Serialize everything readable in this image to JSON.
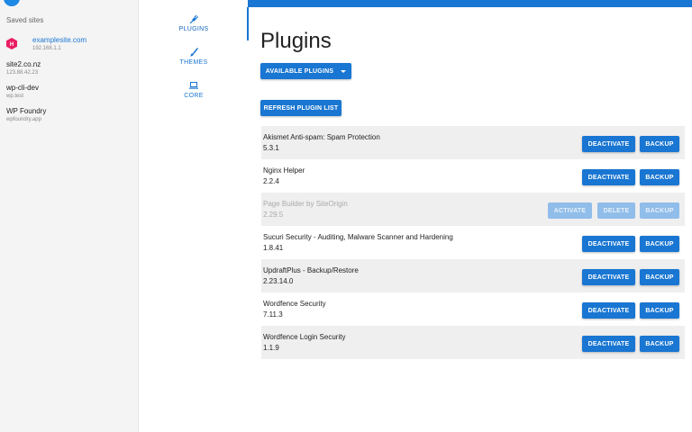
{
  "sidebar": {
    "title": "Saved sites",
    "sites": [
      {
        "name": "examplesite.com",
        "host": "192.168.1.1",
        "active": true
      },
      {
        "name": "site2.co.nz",
        "host": "123.88.42.23"
      },
      {
        "name": "wp-cli-dev",
        "host": "wp.test"
      },
      {
        "name": "WP Foundry",
        "host": "wpfoundry.app"
      }
    ]
  },
  "nav": {
    "items": [
      {
        "label": "PLUGINS",
        "icon": "plug-icon"
      },
      {
        "label": "THEMES",
        "icon": "brush-icon"
      },
      {
        "label": "CORE",
        "icon": "laptop-icon"
      }
    ]
  },
  "main": {
    "title": "Plugins",
    "available_label": "AVAILABLE PLUGINS",
    "refresh_label": "REFRESH PLUGIN LIST"
  },
  "plugins": [
    {
      "name": "Akismet Anti-spam: Spam Protection",
      "version": "5.3.1",
      "active": true
    },
    {
      "name": "Nginx Helper",
      "version": "2.2.4",
      "active": true
    },
    {
      "name": "Page Builder by SiteOrigin",
      "version": "2.29.5",
      "active": false
    },
    {
      "name": "Sucuri Security - Auditing, Malware Scanner and Hardening",
      "version": "1.8.41",
      "active": true
    },
    {
      "name": "UpdraftPlus - Backup/Restore",
      "version": "2.23.14.0",
      "active": true
    },
    {
      "name": "Wordfence Security",
      "version": "7.11.3",
      "active": true
    },
    {
      "name": "Wordfence Login Security",
      "version": "1.1.9",
      "active": true
    }
  ],
  "actions": {
    "deactivate": "DEACTIVATE",
    "backup": "BACKUP",
    "activate": "ACTIVATE",
    "delete": "DELETE"
  },
  "colors": {
    "accent": "#1976d2",
    "accent_disabled": "#90bde9",
    "sidebar_bg": "#f4f4f4",
    "row_shade": "#efefef",
    "site_icon": "#e91e63"
  }
}
